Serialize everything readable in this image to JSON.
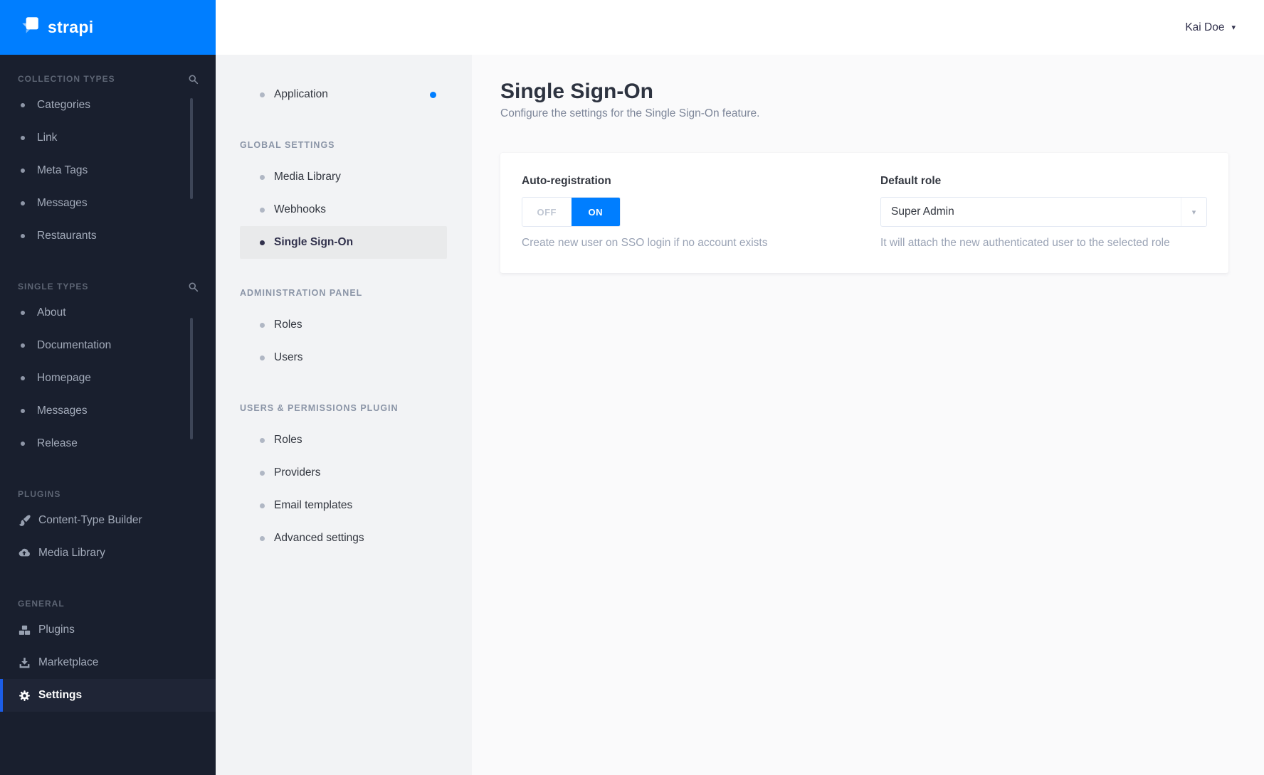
{
  "colors": {
    "accent_blue": "#007eff",
    "active_border_blue": "#1c5de6",
    "sidebar_bg": "#191f2e",
    "sidebar_active_bg": "#1f2536",
    "subnav_bg": "#f2f3f5",
    "subnav_active_bg": "#e9eaeb",
    "main_bg": "#fafafb",
    "field_border": "#e3e9f3",
    "heading_text": "#2d3340",
    "muted_text": "#9aa3b5"
  },
  "brand": {
    "name": "strapi"
  },
  "topbar": {
    "user_name": "Kai Doe"
  },
  "sidebar": {
    "sections": [
      {
        "label": "COLLECTION TYPES",
        "items": [
          {
            "label": "Categories"
          },
          {
            "label": "Link"
          },
          {
            "label": "Meta Tags"
          },
          {
            "label": "Messages"
          },
          {
            "label": "Restaurants"
          }
        ]
      },
      {
        "label": "SINGLE TYPES",
        "items": [
          {
            "label": "About"
          },
          {
            "label": "Documentation"
          },
          {
            "label": "Homepage"
          },
          {
            "label": "Messages"
          },
          {
            "label": "Release"
          }
        ]
      },
      {
        "label": "PLUGINS",
        "items": [
          {
            "label": "Content-Type Builder",
            "icon": "paintbrush-icon"
          },
          {
            "label": "Media Library",
            "icon": "cloud-upload-icon"
          }
        ]
      },
      {
        "label": "GENERAL",
        "items": [
          {
            "label": "Plugins",
            "icon": "cubes-icon"
          },
          {
            "label": "Marketplace",
            "icon": "download-icon"
          },
          {
            "label": "Settings",
            "icon": "gear-icon",
            "active": true
          }
        ]
      }
    ]
  },
  "subnav": {
    "application": {
      "label": "Application",
      "has_notification": true
    },
    "sections": [
      {
        "label": "GLOBAL SETTINGS",
        "items": [
          {
            "label": "Media Library"
          },
          {
            "label": "Webhooks"
          },
          {
            "label": "Single Sign-On",
            "active": true
          }
        ]
      },
      {
        "label": "ADMINISTRATION PANEL",
        "items": [
          {
            "label": "Roles"
          },
          {
            "label": "Users"
          }
        ]
      },
      {
        "label": "USERS & PERMISSIONS PLUGIN",
        "items": [
          {
            "label": "Roles"
          },
          {
            "label": "Providers"
          },
          {
            "label": "Email templates"
          },
          {
            "label": "Advanced settings"
          }
        ]
      }
    ]
  },
  "main": {
    "title": "Single Sign-On",
    "subtitle": "Configure the settings for the Single Sign-On feature.",
    "auto_registration": {
      "label": "Auto-registration",
      "off_label": "OFF",
      "on_label": "ON",
      "value": "ON",
      "helper": "Create new user on SSO login if no account exists"
    },
    "default_role": {
      "label": "Default role",
      "value": "Super Admin",
      "helper": "It will attach the new authenticated user to the selected role"
    }
  }
}
